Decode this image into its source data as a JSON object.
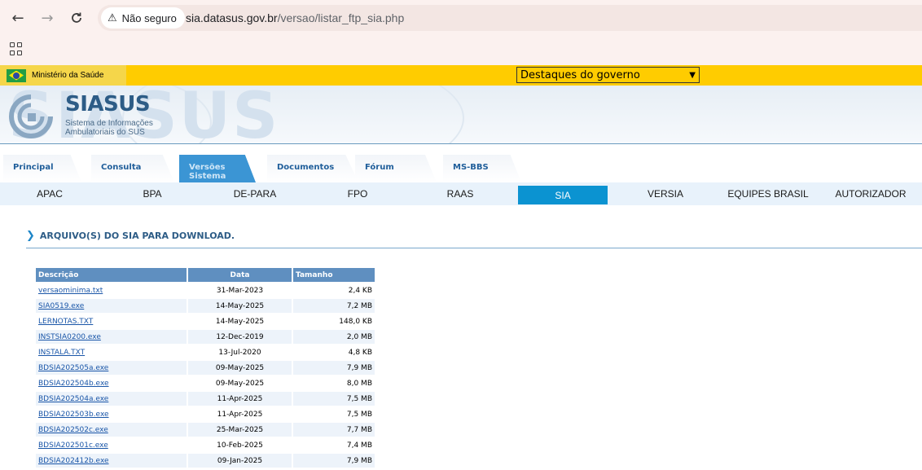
{
  "browser": {
    "security_label": "Não seguro",
    "url_host": "sia.datasus.gov.br",
    "url_path": "/versao/listar_ftp_sia.php"
  },
  "gov_bar": {
    "ministry": "Ministério da Saúde",
    "dropdown_selected": "Destaques do governo"
  },
  "header": {
    "logo_title": "SIASUS",
    "logo_subtitle_1": "Sistema de Informações",
    "logo_subtitle_2": "Ambulatoriais do SUS",
    "watermark": "SIASUS"
  },
  "tabs": [
    {
      "label": "Principal"
    },
    {
      "label": "Consulta"
    },
    {
      "label": "Versões\nSistema",
      "active": true
    },
    {
      "label": "Documentos"
    },
    {
      "label": "Fórum"
    },
    {
      "label": "MS-BBS"
    }
  ],
  "subnav": [
    {
      "label": "APAC"
    },
    {
      "label": "BPA"
    },
    {
      "label": "DE-PARA"
    },
    {
      "label": "FPO"
    },
    {
      "label": "RAAS"
    },
    {
      "label": "SIA",
      "active": true
    },
    {
      "label": "VERSIA"
    },
    {
      "label": "EQUIPES BRASIL"
    },
    {
      "label": "AUTORIZADOR"
    }
  ],
  "section_title": "ARQUIVO(S) DO SIA PARA DOWNLOAD.",
  "table": {
    "headers": {
      "name": "Descrição",
      "date": "Data",
      "size": "Tamanho"
    },
    "rows": [
      {
        "name": "versaominima.txt",
        "date": "31-Mar-2023",
        "size": "2,4 KB"
      },
      {
        "name": "SIA0519.exe",
        "date": "14-May-2025",
        "size": "7,2 MB"
      },
      {
        "name": "LERNOTAS.TXT",
        "date": "14-May-2025",
        "size": "148,0 KB"
      },
      {
        "name": "INSTSIA0200.exe",
        "date": "12-Dec-2019",
        "size": "2,0 MB"
      },
      {
        "name": "INSTALA.TXT",
        "date": "13-Jul-2020",
        "size": "4,8 KB"
      },
      {
        "name": "BDSIA202505a.exe",
        "date": "09-May-2025",
        "size": "7,9 MB"
      },
      {
        "name": "BDSIA202504b.exe",
        "date": "09-May-2025",
        "size": "8,0 MB"
      },
      {
        "name": "BDSIA202504a.exe",
        "date": "11-Apr-2025",
        "size": "7,5 MB"
      },
      {
        "name": "BDSIA202503b.exe",
        "date": "11-Apr-2025",
        "size": "7,5 MB"
      },
      {
        "name": "BDSIA202502c.exe",
        "date": "25-Mar-2025",
        "size": "7,7 MB"
      },
      {
        "name": "BDSIA202501c.exe",
        "date": "10-Feb-2025",
        "size": "7,4 MB"
      },
      {
        "name": "BDSIA202412b.exe",
        "date": "09-Jan-2025",
        "size": "7,9 MB"
      }
    ]
  }
}
